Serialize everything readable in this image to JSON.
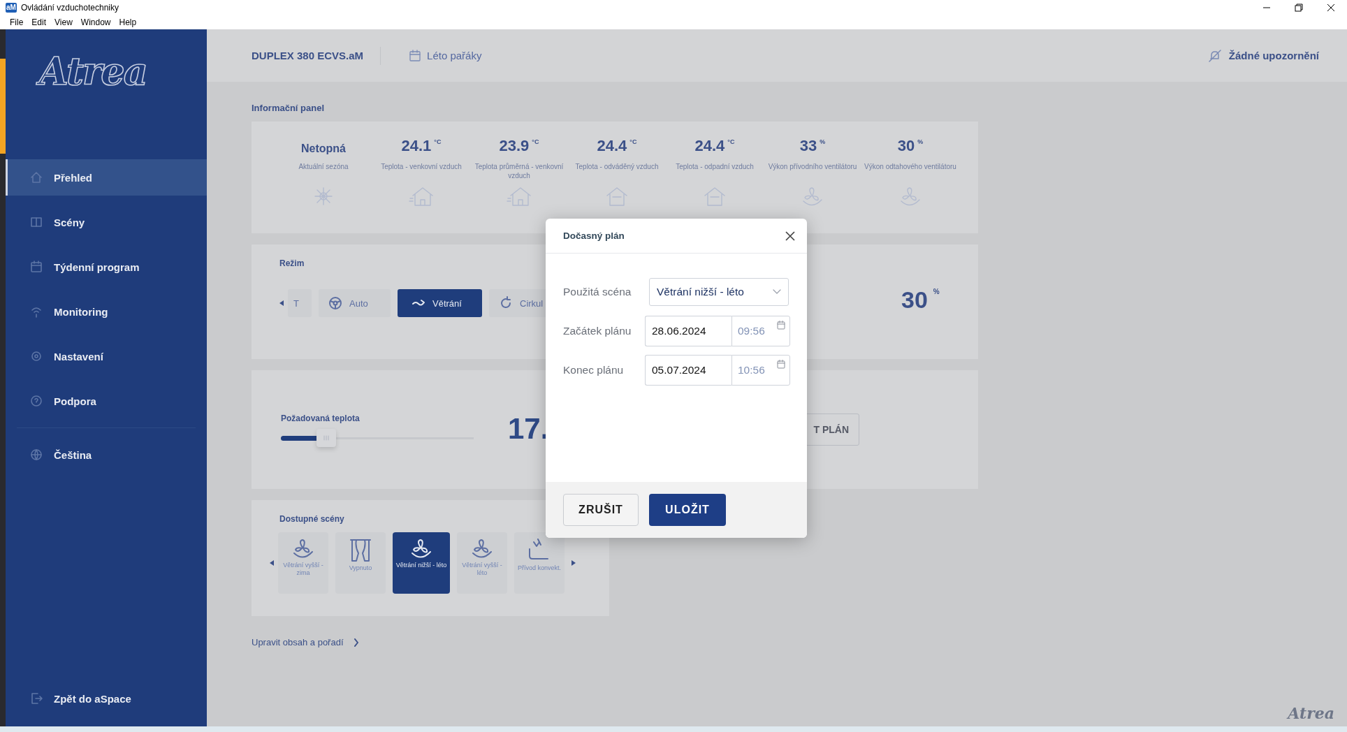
{
  "window": {
    "title": "Ovládání vzduchotechniky",
    "icon_text": "aM"
  },
  "menu": [
    "File",
    "Edit",
    "View",
    "Window",
    "Help"
  ],
  "sidebar": {
    "logo": "Atrea",
    "items": [
      {
        "label": "Přehled",
        "kind": "home",
        "selected": true
      },
      {
        "label": "Scény",
        "kind": "scenes",
        "selected": false
      },
      {
        "label": "Týdenní program",
        "kind": "calendar",
        "selected": false
      },
      {
        "label": "Monitoring",
        "kind": "monitor",
        "selected": false
      },
      {
        "label": "Nastavení",
        "kind": "gear",
        "selected": false
      },
      {
        "label": "Podpora",
        "kind": "help",
        "selected": false
      }
    ],
    "language": "Čeština",
    "back": "Zpět do aSpace"
  },
  "header": {
    "device": "DUPLEX 380 ECVS.aM",
    "schedule": "Léto pařáky",
    "notifications": "Žádné upozornění"
  },
  "info_panel": {
    "title": "Informační panel",
    "items": [
      {
        "value": "Netopná",
        "label": "Aktuální sezóna",
        "kind": "season"
      },
      {
        "value": "24.1",
        "unit": "°C",
        "label": "Teplota - venkovní vzduch",
        "kind": "house"
      },
      {
        "value": "23.9",
        "unit": "°C",
        "label": "Teplota průměrná - venkovní vzduch",
        "kind": "house"
      },
      {
        "value": "24.4",
        "unit": "°C",
        "label": "Teplota - odváděný vzduch",
        "kind": "roof"
      },
      {
        "value": "24.4",
        "unit": "°C",
        "label": "Teplota - odpadní vzduch",
        "kind": "roof"
      },
      {
        "value": "33",
        "unit": "%",
        "label": "Výkon přívodního ventilátoru",
        "kind": "fan"
      },
      {
        "value": "30",
        "unit": "%",
        "label": "Výkon odtahového ventilátoru",
        "kind": "fan"
      }
    ]
  },
  "mode": {
    "title": "Režim",
    "options": [
      {
        "label": "T",
        "kind": "plain",
        "selected": false
      },
      {
        "label": "Auto",
        "kind": "auto",
        "selected": false
      },
      {
        "label": "Větrání",
        "kind": "vent",
        "selected": true
      },
      {
        "label": "Cirkul",
        "kind": "circulation",
        "selected": false
      }
    ],
    "value": "30",
    "unit": "%"
  },
  "temperature": {
    "label": "Požadovaná teplota",
    "level": 0.2,
    "value": "17.",
    "button": "T PLÁN"
  },
  "scenes": {
    "title": "Dostupné scény",
    "items": [
      {
        "label": "Větrání vyšší - zima",
        "kind": "fan",
        "selected": false
      },
      {
        "label": "Vypnuto",
        "kind": "curtain",
        "selected": false
      },
      {
        "label": "Větrání nižší - léto",
        "kind": "fan",
        "selected": true
      },
      {
        "label": "Větrání vyšší - léto",
        "kind": "fan",
        "selected": false
      },
      {
        "label": "Přívod konvekt.",
        "kind": "convector",
        "selected": false
      }
    ],
    "edit_link": "Upravit obsah a pořadí"
  },
  "dialog": {
    "title": "Dočasný plán",
    "fields": [
      {
        "label": "Použitá scéna",
        "kind": "select",
        "value": "Větrání nižší - léto"
      },
      {
        "label": "Začátek plánu",
        "kind": "datetime",
        "date": "28.06.2024",
        "time": "09:56"
      },
      {
        "label": "Konec plánu",
        "kind": "datetime",
        "date": "05.07.2024",
        "time": "10:56"
      }
    ],
    "buttons": [
      {
        "label": "ZRUŠIT",
        "kind": "secondary"
      },
      {
        "label": "ULOŽIT",
        "kind": "primary"
      }
    ]
  },
  "footer_logo": "Atrea"
}
